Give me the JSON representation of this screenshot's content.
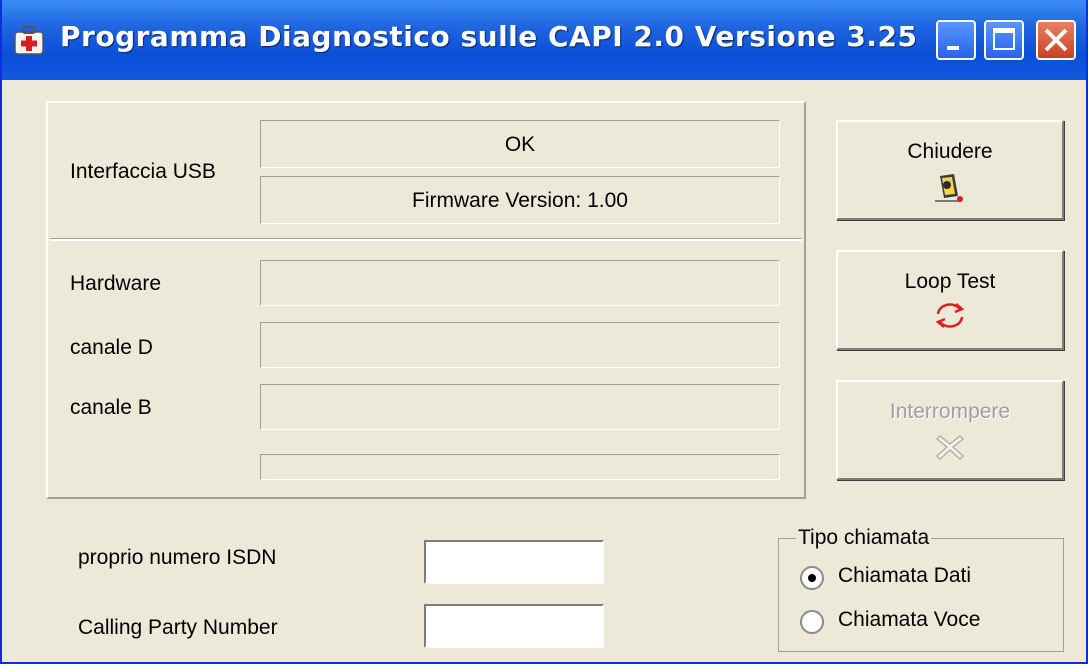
{
  "window": {
    "title": "Programma Diagnostico sulle CAPI 2.0 Versione 3.25"
  },
  "usb": {
    "label": "Interfaccia USB",
    "status": "OK",
    "firmware": "Firmware Version: 1.00"
  },
  "rows": {
    "hardware_label": "Hardware",
    "hardware_value": "",
    "canale_d_label": "canale D",
    "canale_d_value": "",
    "canale_b_label": "canale B",
    "canale_b_value": "",
    "progress_value": 0
  },
  "buttons": {
    "close_label": "Chiudere",
    "loop_test_label": "Loop Test",
    "interrupt_label": "Interrompere",
    "interrupt_enabled": false
  },
  "inputs": {
    "own_isdn_label": "proprio numero ISDN",
    "own_isdn_value": "",
    "calling_party_label": "Calling Party Number",
    "calling_party_value": ""
  },
  "tipo_chiamata": {
    "legend": "Tipo chiamata",
    "options": [
      {
        "label": "Chiamata Dati",
        "selected": true
      },
      {
        "label": "Chiamata Voce",
        "selected": false
      }
    ]
  },
  "icons": [
    "app-icon",
    "minimize-icon",
    "maximize-icon",
    "close-icon",
    "exit-icon",
    "loop-icon",
    "interrupt-icon"
  ]
}
